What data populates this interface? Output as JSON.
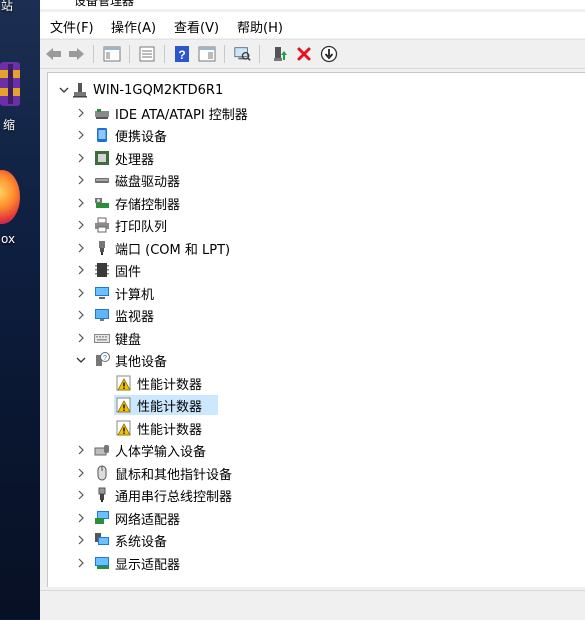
{
  "window": {
    "title_fragment": "设备管理器"
  },
  "desktop": {
    "icons": [
      {
        "label": "站",
        "name": "desktop-shortcut-top"
      },
      {
        "label": "缩",
        "name": "winrar-shortcut"
      },
      {
        "label": "ox",
        "name": "firefox-shortcut"
      }
    ]
  },
  "menu": {
    "file": "文件(F)",
    "action": "操作(A)",
    "view": "查看(V)",
    "help": "帮助(H)"
  },
  "toolbar": {
    "icons": [
      "back-arrow-icon",
      "forward-arrow-icon",
      "show-hide-console-tree-icon",
      "properties-icon",
      "help-icon",
      "action-pane-icon",
      "scan-hardware-changes-icon",
      "update-driver-icon",
      "uninstall-device-icon",
      "disable-device-icon"
    ]
  },
  "tree": {
    "root": "WIN-1GQM2KTD6R1",
    "categories": [
      {
        "label": "IDE ATA/ATAPI 控制器",
        "icon": "ide-controller-icon",
        "expanded": false
      },
      {
        "label": "便携设备",
        "icon": "portable-device-icon",
        "expanded": false
      },
      {
        "label": "处理器",
        "icon": "processor-icon",
        "expanded": false
      },
      {
        "label": "磁盘驱动器",
        "icon": "disk-drive-icon",
        "expanded": false
      },
      {
        "label": "存储控制器",
        "icon": "storage-controller-icon",
        "expanded": false
      },
      {
        "label": "打印队列",
        "icon": "printer-icon",
        "expanded": false
      },
      {
        "label": "端口 (COM 和 LPT)",
        "icon": "port-icon",
        "expanded": false
      },
      {
        "label": "固件",
        "icon": "firmware-icon",
        "expanded": false
      },
      {
        "label": "计算机",
        "icon": "computer-icon",
        "expanded": false
      },
      {
        "label": "监视器",
        "icon": "monitor-icon",
        "expanded": false
      },
      {
        "label": "键盘",
        "icon": "keyboard-icon",
        "expanded": false
      },
      {
        "label": "其他设备",
        "icon": "other-device-icon",
        "expanded": true,
        "children": [
          {
            "label": "性能计数器",
            "icon": "warning-device-icon",
            "selected": false
          },
          {
            "label": "性能计数器",
            "icon": "warning-device-icon",
            "selected": true
          },
          {
            "label": "性能计数器",
            "icon": "warning-device-icon",
            "selected": false
          }
        ]
      },
      {
        "label": "人体学输入设备",
        "icon": "hid-icon",
        "expanded": false
      },
      {
        "label": "鼠标和其他指针设备",
        "icon": "mouse-icon",
        "expanded": false
      },
      {
        "label": "通用串行总线控制器",
        "icon": "usb-icon",
        "expanded": false
      },
      {
        "label": "网络适配器",
        "icon": "network-adapter-icon",
        "expanded": false
      },
      {
        "label": "系统设备",
        "icon": "system-device-icon",
        "expanded": false
      },
      {
        "label": "显示适配器",
        "icon": "display-adapter-icon",
        "expanded": false
      }
    ]
  },
  "colors": {
    "selection": "#cce8ff",
    "accent_blue": "#0078d7",
    "uninstall_red": "#e81123",
    "warning_yellow": "#f2c200"
  }
}
